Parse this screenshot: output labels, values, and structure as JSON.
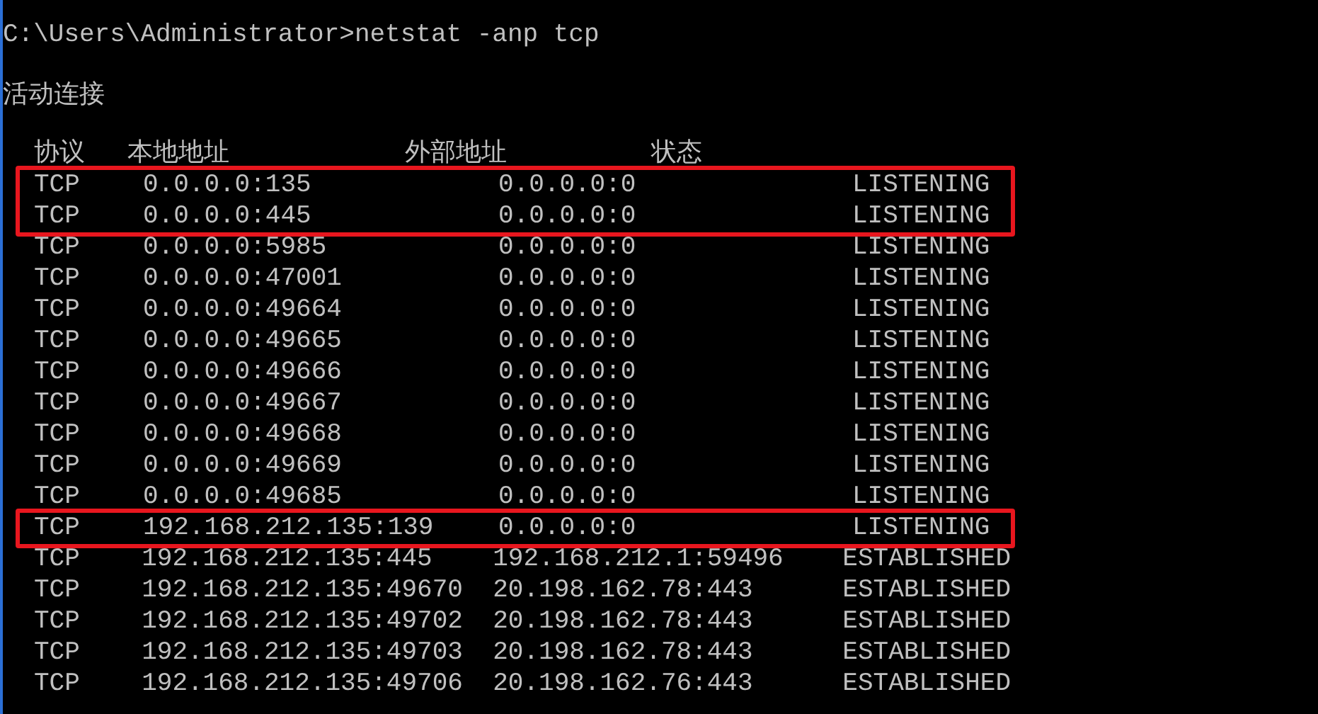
{
  "command_line": "C:\\Users\\Administrator>netstat -anp tcp",
  "section_title": "活动连接",
  "table": {
    "columns": [
      "协议",
      "本地地址",
      "外部地址",
      "状态"
    ],
    "rows": [
      {
        "proto": "TCP",
        "local": "0.0.0.0:135",
        "foreign": "0.0.0.0:0",
        "state": "LISTENING",
        "highlighted": true
      },
      {
        "proto": "TCP",
        "local": "0.0.0.0:445",
        "foreign": "0.0.0.0:0",
        "state": "LISTENING",
        "highlighted": true
      },
      {
        "proto": "TCP",
        "local": "0.0.0.0:5985",
        "foreign": "0.0.0.0:0",
        "state": "LISTENING",
        "highlighted": false
      },
      {
        "proto": "TCP",
        "local": "0.0.0.0:47001",
        "foreign": "0.0.0.0:0",
        "state": "LISTENING",
        "highlighted": false
      },
      {
        "proto": "TCP",
        "local": "0.0.0.0:49664",
        "foreign": "0.0.0.0:0",
        "state": "LISTENING",
        "highlighted": false
      },
      {
        "proto": "TCP",
        "local": "0.0.0.0:49665",
        "foreign": "0.0.0.0:0",
        "state": "LISTENING",
        "highlighted": false
      },
      {
        "proto": "TCP",
        "local": "0.0.0.0:49666",
        "foreign": "0.0.0.0:0",
        "state": "LISTENING",
        "highlighted": false
      },
      {
        "proto": "TCP",
        "local": "0.0.0.0:49667",
        "foreign": "0.0.0.0:0",
        "state": "LISTENING",
        "highlighted": false
      },
      {
        "proto": "TCP",
        "local": "0.0.0.0:49668",
        "foreign": "0.0.0.0:0",
        "state": "LISTENING",
        "highlighted": false
      },
      {
        "proto": "TCP",
        "local": "0.0.0.0:49669",
        "foreign": "0.0.0.0:0",
        "state": "LISTENING",
        "highlighted": false
      },
      {
        "proto": "TCP",
        "local": "0.0.0.0:49685",
        "foreign": "0.0.0.0:0",
        "state": "LISTENING",
        "highlighted": false
      },
      {
        "proto": "TCP",
        "local": "192.168.212.135:139",
        "foreign": "0.0.0.0:0",
        "state": "LISTENING",
        "highlighted": true
      },
      {
        "proto": "TCP",
        "local": "192.168.212.135:445",
        "foreign": "192.168.212.1:59496",
        "state": "ESTABLISHED",
        "highlighted": false
      },
      {
        "proto": "TCP",
        "local": "192.168.212.135:49670",
        "foreign": "20.198.162.78:443",
        "state": "ESTABLISHED",
        "highlighted": false
      },
      {
        "proto": "TCP",
        "local": "192.168.212.135:49702",
        "foreign": "20.198.162.78:443",
        "state": "ESTABLISHED",
        "highlighted": false
      },
      {
        "proto": "TCP",
        "local": "192.168.212.135:49703",
        "foreign": "20.198.162.78:443",
        "state": "ESTABLISHED",
        "highlighted": false
      },
      {
        "proto": "TCP",
        "local": "192.168.212.135:49706",
        "foreign": "20.198.162.76:443",
        "state": "ESTABLISHED",
        "highlighted": false
      }
    ]
  }
}
